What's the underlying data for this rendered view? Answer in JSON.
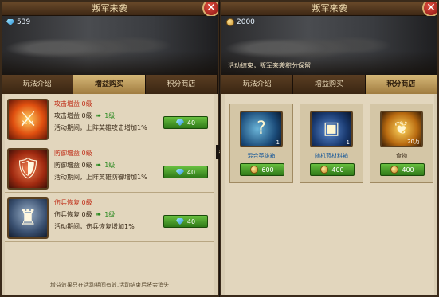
{
  "left": {
    "title": "叛军来袭",
    "currency_value": "539",
    "tabs": [
      "玩法介绍",
      "增益购买",
      "积分商店"
    ],
    "items": [
      {
        "name": "攻击增益 0级",
        "current": "攻击增益 0级",
        "next": "1级",
        "desc": "活动期间，上阵英雄攻击增加1%",
        "price": "40",
        "icon": "sword-icon"
      },
      {
        "name": "防御增益 0级",
        "current": "防御增益 0级",
        "next": "1级",
        "desc": "活动期间，上阵英雄防御增加1%",
        "price": "40",
        "icon": "shield-icon"
      },
      {
        "name": "伤兵恢复 0级",
        "current": "伤兵恢复 0级",
        "next": "1级",
        "desc": "活动期间，伤兵恢复增加1%",
        "price": "40",
        "icon": "knight-icon"
      }
    ],
    "footer": "增益效果只在活动期间有效,活动结束后将会消失"
  },
  "right": {
    "title": "叛军来袭",
    "currency_value": "2000",
    "notice": "活动结束，叛军来袭积分保留",
    "tabs": [
      "玩法介绍",
      "增益购买",
      "积分商店"
    ],
    "shop": [
      {
        "name": "混合英雄箱",
        "qty": "1",
        "price": "600",
        "icon": "mystery-box-icon"
      },
      {
        "name": "随机蓝材料箱",
        "qty": "1",
        "price": "400",
        "icon": "treasure-chest-icon"
      },
      {
        "name": "食物",
        "qty": "20万",
        "price": "400",
        "icon": "wheat-icon"
      }
    ]
  },
  "colors": {
    "accent_green": "#2f7a18",
    "tab_active": "#d6b878",
    "level_red": "#c0301a"
  }
}
